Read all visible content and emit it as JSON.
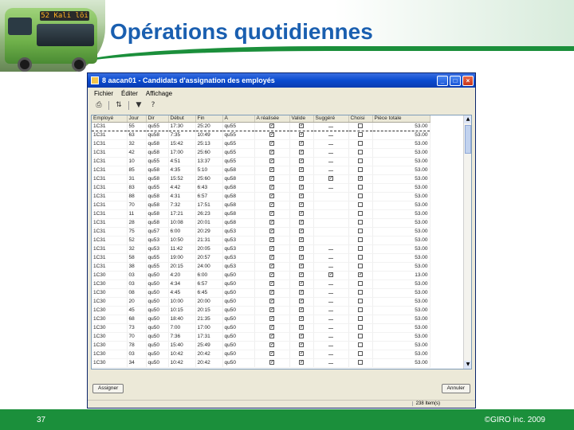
{
  "slide": {
    "title": "Opérations quotidiennes",
    "page_number": "37",
    "copyright": "©GIRO inc. 2009"
  },
  "bus": {
    "sign": "52 Kali lõi"
  },
  "window": {
    "title": "8 aacan01 - Candidats d'assignation des employés",
    "menu": [
      "Fichier",
      "Éditer",
      "Affichage"
    ],
    "buttons": {
      "minimize": "_",
      "maximize": "□",
      "close": "×"
    },
    "toolbar_icons": [
      "print-icon",
      "sort-icon",
      "filter-icon",
      "help-icon"
    ],
    "columns": [
      "Employé",
      "Jour",
      "Dir",
      "Début",
      "Fin",
      "À",
      "A réalisée",
      "Valide",
      "Suggéré",
      "Choisi",
      "Pièce totale"
    ],
    "rows": [
      [
        "1C31",
        "55",
        "qu55",
        "17:30",
        "25:20",
        "qu55",
        "y",
        "y",
        "-",
        "n",
        "53.00"
      ],
      [
        "1C31",
        "63",
        "qu58",
        "7:35",
        "10:49",
        "qu55",
        "y",
        "y",
        "-",
        "n",
        "53.00"
      ],
      [
        "1C31",
        "32",
        "qu58",
        "15:42",
        "25:13",
        "qu55",
        "y",
        "y",
        "-",
        "n",
        "53.00"
      ],
      [
        "1C31",
        "42",
        "qu58",
        "17:00",
        "25:60",
        "qu55",
        "y",
        "y",
        "-",
        "n",
        "53.00"
      ],
      [
        "1C31",
        "10",
        "qu55",
        "4:51",
        "13:37",
        "qu55",
        "y",
        "y",
        "-",
        "n",
        "53.00"
      ],
      [
        "1C31",
        "85",
        "qu58",
        "4:35",
        "5:10",
        "qu58",
        "y",
        "y",
        "-",
        "n",
        "53.00"
      ],
      [
        "1C31",
        "31",
        "qu58",
        "15:52",
        "25:60",
        "qu58",
        "y",
        "y",
        "y",
        "y",
        "53.00"
      ],
      [
        "1C31",
        "83",
        "qu55",
        "4:42",
        "6:43",
        "qu58",
        "y",
        "y",
        "-",
        "n",
        "53.00"
      ],
      [
        "1C31",
        "88",
        "qu58",
        "4:31",
        "6:57",
        "qu58",
        "y",
        "y",
        "",
        "n",
        "53.00"
      ],
      [
        "1C31",
        "70",
        "qu58",
        "7:32",
        "17:51",
        "qu58",
        "y",
        "y",
        "",
        "n",
        "53.00"
      ],
      [
        "1C31",
        "11",
        "qu58",
        "17:21",
        "26:23",
        "qu58",
        "y",
        "y",
        "",
        "n",
        "53.00"
      ],
      [
        "1C31",
        "28",
        "qu58",
        "10:08",
        "20:01",
        "qu58",
        "y",
        "y",
        "",
        "n",
        "53.00"
      ],
      [
        "1C31",
        "75",
        "qu57",
        "6:00",
        "20:29",
        "qu53",
        "y",
        "y",
        "",
        "n",
        "53.00"
      ],
      [
        "1C31",
        "52",
        "qu53",
        "10:50",
        "21:31",
        "qu53",
        "y",
        "y",
        "",
        "n",
        "53.00"
      ],
      [
        "1C31",
        "32",
        "qu53",
        "11:42",
        "20:05",
        "qu53",
        "y",
        "y",
        "-",
        "n",
        "53.00"
      ],
      [
        "1C31",
        "58",
        "qu55",
        "19:00",
        "20:57",
        "qu53",
        "y",
        "y",
        "-",
        "n",
        "53.00"
      ],
      [
        "1C31",
        "38",
        "qu55",
        "20:15",
        "24:00",
        "qu53",
        "y",
        "y",
        "-",
        "n",
        "53.00"
      ],
      [
        "1C30",
        "03",
        "qu50",
        "4:20",
        "6:00",
        "qu50",
        "y",
        "y",
        "y",
        "y",
        "13.00"
      ],
      [
        "1C30",
        "03",
        "qu50",
        "4:34",
        "6:57",
        "qu50",
        "y",
        "y",
        "-",
        "n",
        "53.00"
      ],
      [
        "1C30",
        "08",
        "qu50",
        "4:45",
        "6:45",
        "qu50",
        "y",
        "y",
        "-",
        "n",
        "53.00"
      ],
      [
        "1C30",
        "20",
        "qu50",
        "10:00",
        "20:00",
        "qu50",
        "y",
        "y",
        "-",
        "n",
        "53.00"
      ],
      [
        "1C30",
        "45",
        "qu50",
        "10:15",
        "20:15",
        "qu50",
        "y",
        "y",
        "-",
        "n",
        "53.00"
      ],
      [
        "1C30",
        "68",
        "qu50",
        "18:40",
        "21:35",
        "qu50",
        "y",
        "y",
        "-",
        "n",
        "53.00"
      ],
      [
        "1C30",
        "73",
        "qu50",
        "7:00",
        "17:00",
        "qu50",
        "y",
        "y",
        "-",
        "n",
        "53.00"
      ],
      [
        "1C30",
        "70",
        "qu50",
        "7:36",
        "17:31",
        "qu50",
        "y",
        "y",
        "-",
        "n",
        "53.00"
      ],
      [
        "1C30",
        "78",
        "qu50",
        "15:40",
        "25:49",
        "qu50",
        "y",
        "y",
        "-",
        "n",
        "53.00"
      ],
      [
        "1C30",
        "03",
        "qu50",
        "10:42",
        "20:42",
        "qu50",
        "y",
        "y",
        "-",
        "n",
        "53.00"
      ],
      [
        "1C30",
        "34",
        "qu50",
        "10:42",
        "20:42",
        "qu50",
        "y",
        "y",
        "-",
        "n",
        "53.00"
      ]
    ],
    "footer_left_button": "Assigner",
    "footer_right_button": "Annuler",
    "status": "238 Item(s)"
  }
}
